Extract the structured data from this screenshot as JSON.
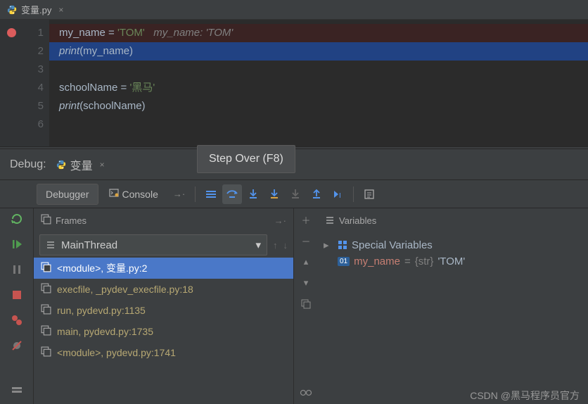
{
  "editor": {
    "tab_name": "变量.py",
    "lines": [
      {
        "n": "1",
        "bp": true,
        "segments": [
          {
            "t": "my_name ",
            "c": "kw"
          },
          {
            "t": "= ",
            "c": "kw"
          },
          {
            "t": "'TOM'",
            "c": "str"
          },
          {
            "t": "   ",
            "c": ""
          },
          {
            "t": "my_name: 'TOM'",
            "c": "hint"
          }
        ],
        "bg": "cl0"
      },
      {
        "n": "2",
        "bp": false,
        "segments": [
          {
            "t": "print",
            "c": "printf"
          },
          {
            "t": "(my_name)",
            "c": "kw"
          }
        ],
        "bg": "cl1"
      },
      {
        "n": "3",
        "bp": false,
        "segments": [],
        "bg": ""
      },
      {
        "n": "4",
        "bp": false,
        "segments": [
          {
            "t": "schoolName ",
            "c": "kw"
          },
          {
            "t": "= ",
            "c": "kw"
          },
          {
            "t": "'黑马'",
            "c": "str"
          }
        ],
        "bg": ""
      },
      {
        "n": "5",
        "bp": false,
        "segments": [
          {
            "t": "print",
            "c": "printf"
          },
          {
            "t": "(schoolName)",
            "c": "kw"
          }
        ],
        "bg": ""
      },
      {
        "n": "6",
        "bp": false,
        "segments": [],
        "bg": ""
      }
    ]
  },
  "debug": {
    "label": "Debug:",
    "tab_name": "变量",
    "tooltip": "Step Over (F8)",
    "subtabs": {
      "debugger": "Debugger",
      "console": "Console"
    }
  },
  "frames": {
    "title": "Frames",
    "thread": "MainThread",
    "items": [
      {
        "text": "<module>, 变量.py:2",
        "sel": true
      },
      {
        "text": "execfile, _pydev_execfile.py:18",
        "sel": false
      },
      {
        "text": "run, pydevd.py:1135",
        "sel": false
      },
      {
        "text": "main, pydevd.py:1735",
        "sel": false
      },
      {
        "text": "<module>, pydevd.py:1741",
        "sel": false
      }
    ]
  },
  "variables": {
    "title": "Variables",
    "special": "Special Variables",
    "items": [
      {
        "badge": "01",
        "name": "my_name",
        "type": "{str}",
        "value": "'TOM'"
      }
    ]
  },
  "watermark": "CSDN @黑马程序员官方"
}
